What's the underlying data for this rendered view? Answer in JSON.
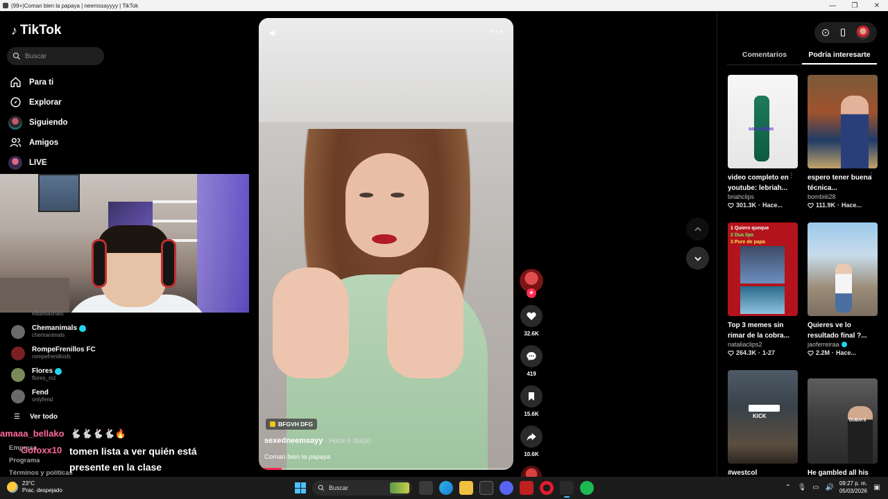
{
  "window": {
    "title": "(99+)Coman bien la papaya | neemssayyyy | TikTok",
    "controls": [
      "—",
      "❐",
      "✕"
    ]
  },
  "sidebar": {
    "logo": "TikTok",
    "search_placeholder": "Buscar",
    "nav": [
      {
        "label": "Para ti",
        "icon": "home-icon"
      },
      {
        "label": "Explorar",
        "icon": "compass-icon"
      },
      {
        "label": "Siguiendo",
        "icon": "following-avatar-icon"
      },
      {
        "label": "Amigos",
        "icon": "friends-icon"
      },
      {
        "label": "LIVE",
        "icon": "live-avatar-icon"
      }
    ],
    "partial_handle": "elbarbashats",
    "following": [
      {
        "name": "Chemanimals",
        "handle": "chemanimals",
        "verified": true,
        "color": "#6b6b6b"
      },
      {
        "name": "RompeFrenillos FC",
        "handle": "rompefrenillosfc",
        "verified": false,
        "color": "#7a2020"
      },
      {
        "name": "Flores",
        "handle": "flores_mz",
        "verified": true,
        "color": "#7a8a5a"
      },
      {
        "name": "Fend",
        "handle": "onlyfend",
        "verified": false,
        "color": "#6a6a6a"
      }
    ],
    "see_all": "Ver todo",
    "footer": [
      "Empresa",
      "Programa",
      "Términos y políticas"
    ]
  },
  "chat": {
    "user1": "amaaa_bellako",
    "user1_emojis": "🐇🐇🐇🐇🔥",
    "user2": "Gofoxx10",
    "message": "tomen lista a ver quién está presente en la clase"
  },
  "video": {
    "badge": "BFGVH DFG",
    "author": "sexedneemsayy",
    "time": " · Hace 6 día(s)",
    "caption": "Coman bien la papaya",
    "progress": 0.09,
    "more": "···"
  },
  "actions": {
    "likes": "32.6K",
    "comments": "419",
    "saves": "15.6K",
    "shares": "10.6K"
  },
  "right_panel": {
    "tabs": [
      "Comentarios",
      "Podría interesarte"
    ],
    "active_tab": 1,
    "cards": [
      {
        "title": "video completo en youtube: lebriah...",
        "author": "briahclips",
        "verified": false,
        "views": "301.3K",
        "when": "Hace..."
      },
      {
        "title": "espero tener buena técnica...",
        "author": "bombiiii28",
        "verified": false,
        "views": "111.9K",
        "when": "Hace..."
      },
      {
        "title": "Top 3 memes sin rimar de la cobra...",
        "author": "nataliaclips2",
        "verified": false,
        "views": "264.3K",
        "when": "1-27"
      },
      {
        "title": "Quieres ve lo resultado final ?...",
        "author": "jaoferreiraa",
        "verified": true,
        "views": "2.2M",
        "when": "Hace..."
      },
      {
        "title": "#westcol",
        "author": "",
        "verified": false,
        "views": "",
        "when": ""
      },
      {
        "title": "He gambled all his",
        "author": "",
        "verified": false,
        "views": "",
        "when": ""
      }
    ],
    "thumb_texts": {
      "t1": "son caídas",
      "t3_lines": [
        "1 Quiero queque",
        "2 Dua lipa",
        "3 Pure de papa"
      ],
      "t5": "KICK",
      "t6": "DUBAI'S"
    }
  },
  "taskbar": {
    "temp": "23°C",
    "weather": "Prac. despejado",
    "search": "Buscar",
    "time": "09:27 p. m.",
    "date": "05/03/2026"
  },
  "colors": {
    "accent": "#fe2c55",
    "verified": "#20d5ec",
    "bg": "#000000"
  }
}
